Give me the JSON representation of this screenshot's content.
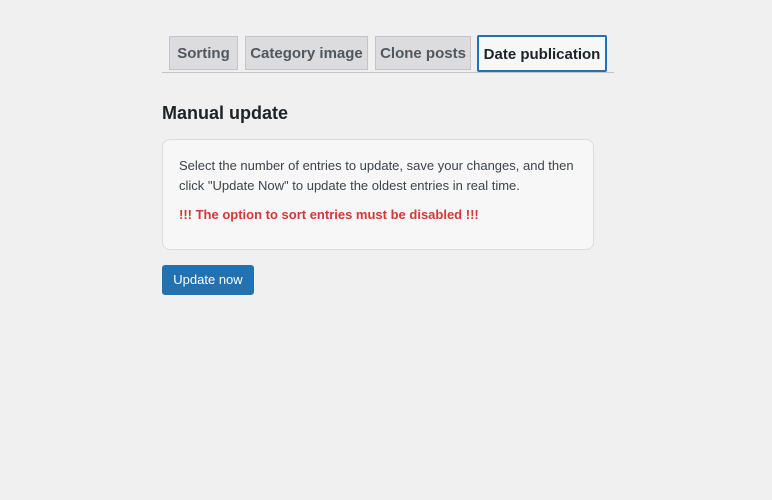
{
  "tabs": [
    {
      "label": "Sorting",
      "active": false
    },
    {
      "label": "Category image",
      "active": false
    },
    {
      "label": "Clone posts",
      "active": false
    },
    {
      "label": "Date publication",
      "active": true
    }
  ],
  "section": {
    "title": "Manual update"
  },
  "notice": {
    "description": "Select the number of entries to update, save your changes, and then click \"Update Now\" to update the oldest entries in real time.",
    "warning": "!!! The option to sort entries must be disabled !!!"
  },
  "actions": {
    "update_label": "Update now"
  },
  "colors": {
    "background": "#f0f0f1",
    "primary": "#2271b1",
    "warning": "#d63638",
    "tab_inactive": "#dcdcde"
  }
}
